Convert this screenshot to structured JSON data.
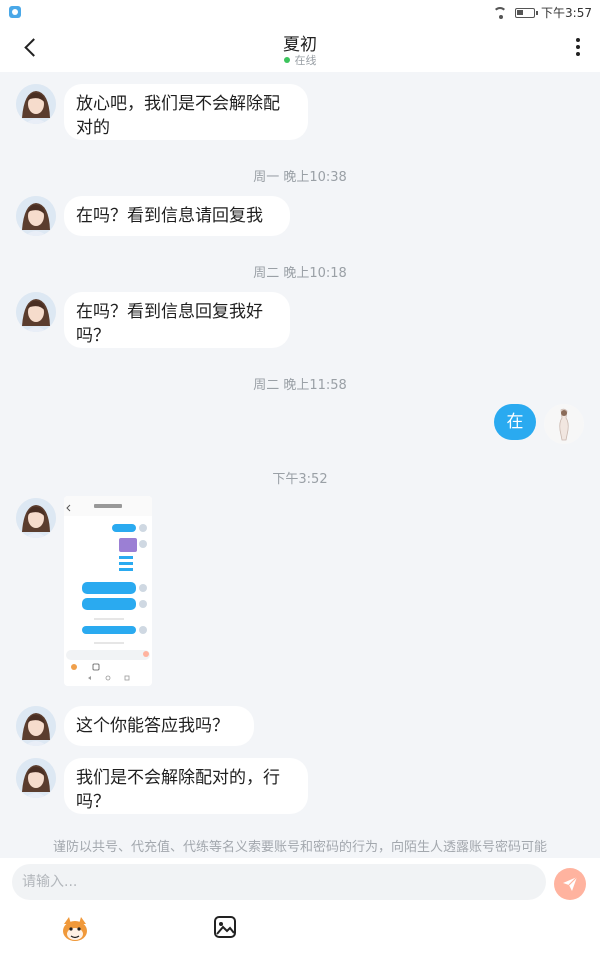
{
  "status_bar": {
    "time": "下午3:57"
  },
  "header": {
    "title": "夏初",
    "status": "在线"
  },
  "messages": [
    {
      "text": "放心吧，我们是不会解除配对的"
    },
    {
      "time": "周一 晚上10:38"
    },
    {
      "text": "在吗？看到信息请回复我"
    },
    {
      "time": "周二 晚上10:18"
    },
    {
      "text": "在吗？看到信息回复我好吗？"
    },
    {
      "time": "周二 晚上11:58"
    },
    {
      "text": "在"
    },
    {
      "time": "下午3:52"
    },
    {
      "text": "这个你能答应我吗？"
    },
    {
      "text": "我们是不会解除配对的，行吗？"
    }
  ],
  "notice": "谨防以共号、代充值、代练等名义索要账号和密码的行为，向陌生人透露账号密码可能",
  "input": {
    "placeholder": "请输入..."
  }
}
